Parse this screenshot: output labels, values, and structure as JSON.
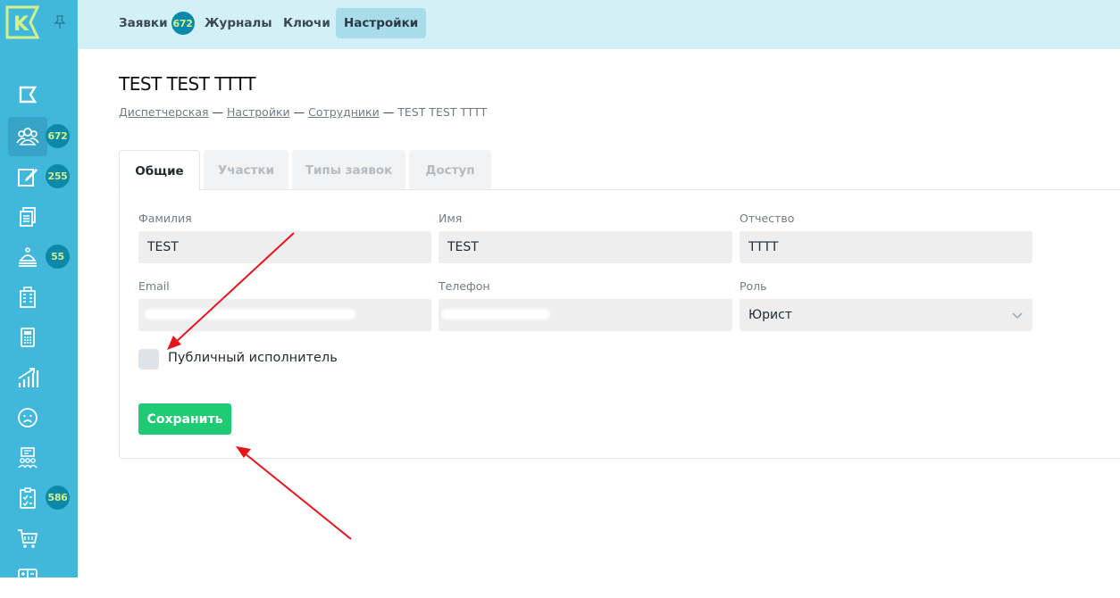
{
  "sidebar": {
    "logo_letter": "K",
    "items": [
      {
        "icon": "flag-icon",
        "badge": null
      },
      {
        "icon": "users-icon",
        "badge": "672",
        "active": true
      },
      {
        "icon": "edit-note-icon",
        "badge": "255"
      },
      {
        "icon": "documents-icon",
        "badge": null
      },
      {
        "icon": "service-bell-icon",
        "badge": "55"
      },
      {
        "icon": "building-icon",
        "badge": null
      },
      {
        "icon": "calculator-icon",
        "badge": null
      },
      {
        "icon": "chart-growth-icon",
        "badge": null
      },
      {
        "icon": "sad-face-icon",
        "badge": null
      },
      {
        "icon": "team-board-icon",
        "badge": null
      },
      {
        "icon": "checklist-icon",
        "badge": "586"
      },
      {
        "icon": "cart-icon",
        "badge": null
      },
      {
        "icon": "calculator-2-icon",
        "badge": null
      }
    ]
  },
  "topnav": {
    "tabs": [
      {
        "label": "Заявки",
        "badge": "672"
      },
      {
        "label": "Журналы"
      },
      {
        "label": "Ключи"
      },
      {
        "label": "Настройки",
        "active": true
      }
    ]
  },
  "page": {
    "title": "TEST TEST TTTT",
    "breadcrumb": [
      "Диспетчерская",
      "Настройки",
      "Сотрудники",
      "TEST TEST TTTT"
    ],
    "breadcrumb_sep": "—"
  },
  "form": {
    "tabs": [
      "Общие",
      "Участки",
      "Типы заявок",
      "Доступ"
    ],
    "active_tab": "Общие",
    "fields": {
      "lastname": {
        "label": "Фамилия",
        "value": "TEST"
      },
      "firstname": {
        "label": "Имя",
        "value": "TEST"
      },
      "patronymic": {
        "label": "Отчество",
        "value": "TTTT"
      },
      "email": {
        "label": "Email",
        "value": ""
      },
      "phone": {
        "label": "Телефон",
        "value": ""
      },
      "role": {
        "label": "Роль",
        "value": "Юрист"
      }
    },
    "public_executor_label": "Публичный исполнитель",
    "public_executor_checked": false,
    "save_label": "Сохранить"
  },
  "colors": {
    "sidebar": "#42b7dc",
    "topbar": "#d3f0f6",
    "badge": "#0a8aa8",
    "badge_text": "#d4f08a",
    "save_button": "#1ecb74",
    "annotation_arrow": "#e8141b"
  }
}
